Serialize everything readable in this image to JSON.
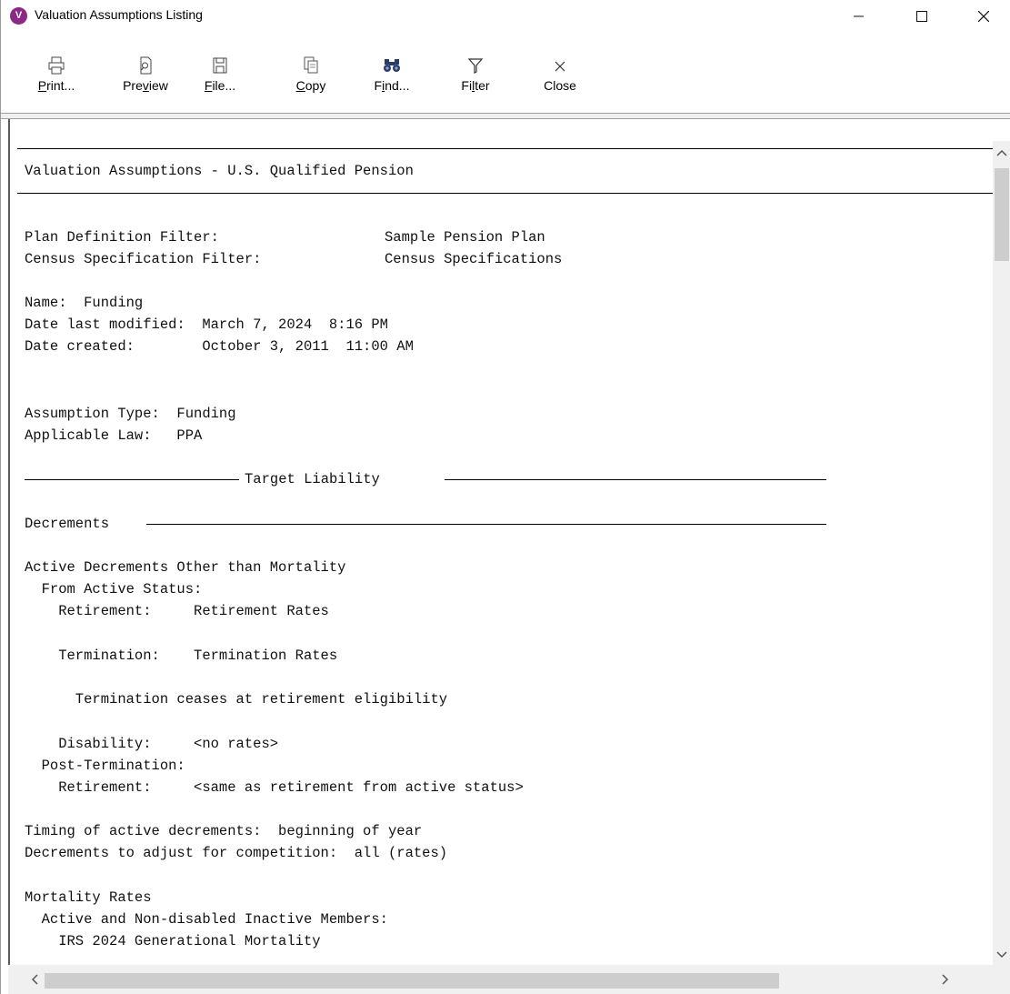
{
  "window": {
    "title": "Valuation Assumptions Listing",
    "icon_letter": "V",
    "icon_color": "#8a2a86"
  },
  "toolbar": {
    "items": [
      {
        "icon": "print-icon",
        "label_pre": "",
        "label_key": "P",
        "label_post": "rint..."
      },
      {
        "icon": "preview-icon",
        "label_pre": "Pre",
        "label_key": "v",
        "label_post": "iew"
      },
      {
        "icon": "save-file-icon",
        "label_pre": "",
        "label_key": "F",
        "label_post": "ile..."
      },
      {
        "icon": "copy-icon",
        "label_pre": "",
        "label_key": "C",
        "label_post": "opy"
      },
      {
        "icon": "binoculars-icon",
        "label_pre": "F",
        "label_key": "i",
        "label_post": "nd..."
      },
      {
        "icon": "filter-icon",
        "label_pre": "Fi",
        "label_key": "l",
        "label_post": "ter"
      },
      {
        "icon": "close-icon",
        "label_pre": "",
        "label_key": "",
        "label_post": "Close"
      }
    ]
  },
  "report": {
    "heading": "Valuation Assumptions - U.S. Qualified Pension",
    "plan_filter_label": "Plan Definition Filter:",
    "plan_filter_value": "Sample Pension Plan",
    "census_filter_label": "Census Specification Filter:",
    "census_filter_value": "Census Specifications",
    "name_line": "Name:  Funding",
    "modified_line": "Date last modified:  March 7, 2024  8:16 PM",
    "created_line": "Date created:        October 3, 2011  11:00 AM",
    "assumption_type_line": "Assumption Type:  Funding",
    "applicable_law_line": "Applicable Law:   PPA",
    "section_target": "Target Liability",
    "section_decrements": "Decrements",
    "active_decrements": "Active Decrements Other than Mortality",
    "from_active": "  From Active Status:",
    "retirement_line": "    Retirement:     Retirement Rates",
    "termination_line": "    Termination:    Termination Rates",
    "termination_note": "      Termination ceases at retirement eligibility",
    "disability_line": "    Disability:     <no rates>",
    "post_termination": "  Post-Termination:",
    "post_retirement_line": "    Retirement:     <same as retirement from active status>",
    "timing_line": "Timing of active decrements:  beginning of year",
    "competition_line": "Decrements to adjust for competition:  all (rates)",
    "mortality_heading": "Mortality Rates",
    "mortality_active": "  Active and Non-disabled Inactive Members:",
    "mortality_table": "    IRS 2024 Generational Mortality"
  }
}
